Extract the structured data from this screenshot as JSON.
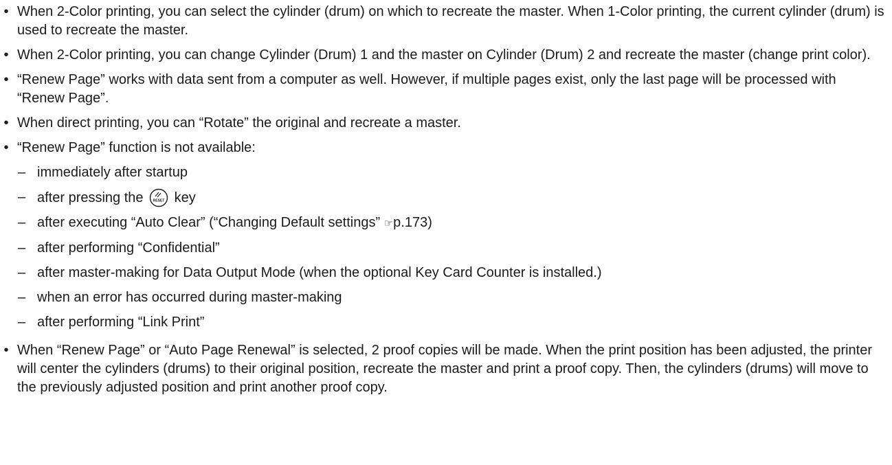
{
  "bullets_top": [
    "When 2-Color printing, you can select the cylinder (drum) on which to recreate the master. When 1-Color printing, the current cylinder (drum) is used to recreate the master.",
    "When 2-Color printing, you can change Cylinder (Drum) 1 and the master on Cylinder (Drum) 2 and recreate the master (change print color).",
    "“Renew Page” works with data sent from a computer as well. However, if multiple pages exist, only the last page will be processed with “Renew Page”.",
    "When direct printing, you can “Rotate” the original and recreate a master.",
    "“Renew Page” function is not available:"
  ],
  "bullet_symbol": "•",
  "dash_symbol": "–",
  "sub_items": {
    "startup": "immediately after startup",
    "reset_before": "after pressing the",
    "reset_after": "key",
    "reset_key_label": "RESET",
    "auto_clear_before": "after executing “Auto Clear” (“Changing Default settings” ",
    "page_ref": "p.173)",
    "confidential": "after performing “Confidential”",
    "data_output": "after master-making for Data Output Mode (when the optional Key Card Counter is installed.)",
    "error": "when an error has occurred during master-making",
    "link_print": "after performing “Link Print”"
  },
  "bullet_last": "When “Renew Page” or “Auto Page Renewal” is selected, 2 proof copies will be made. When the print position has been adjusted, the printer will center the cylinders (drums) to their original position, recreate the master and print a proof copy. Then, the cylinders (drums) will move to the previously adjusted position and print another proof copy.",
  "pointer_icon": "☞",
  "icons": {
    "reset_key": "reset-key-icon",
    "page_reference": "pointing-hand-icon"
  }
}
